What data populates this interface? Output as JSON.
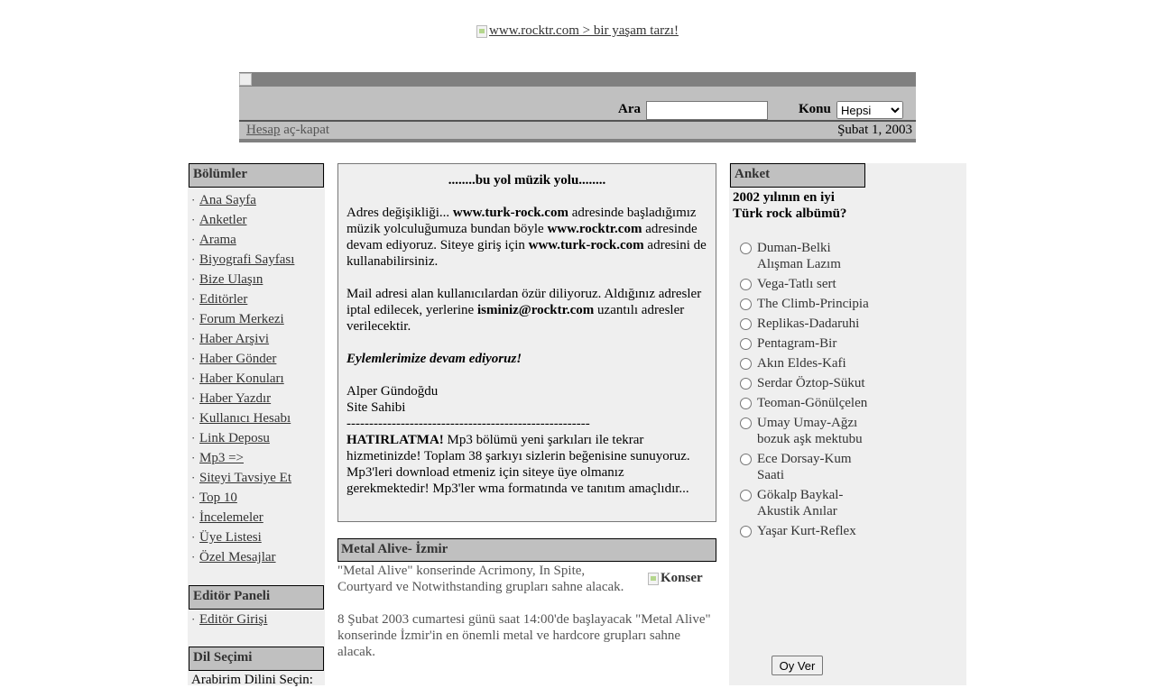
{
  "banner": {
    "alt": "www.rocktr.com > bir yaşam tarzı!"
  },
  "header": {
    "search_label": "Ara",
    "search_value": "",
    "topic_label": "Konu",
    "topic_selected": "Hepsi",
    "account_link": "Hesap",
    "account_toggle": "aç-kapat",
    "date": "Şubat 1, 2003"
  },
  "sidebar": {
    "sections_title": "Bölümler",
    "items": [
      {
        "label": "Ana Sayfa"
      },
      {
        "label": "Anketler"
      },
      {
        "label": "Arama"
      },
      {
        "label": "Biyografi Sayfası"
      },
      {
        "label": "Bize Ulaşın"
      },
      {
        "label": "Editörler"
      },
      {
        "label": "Forum Merkezi"
      },
      {
        "label": "Haber Arşivi"
      },
      {
        "label": "Haber Gönder"
      },
      {
        "label": "Haber Konuları"
      },
      {
        "label": "Haber Yazdır"
      },
      {
        "label": "Kullanıcı Hesabı"
      },
      {
        "label": "Link Deposu"
      },
      {
        "label": "Mp3 =>"
      },
      {
        "label": "Siteyi Tavsiye Et"
      },
      {
        "label": "Top 10"
      },
      {
        "label": "İncelemeler"
      },
      {
        "label": "Üye Listesi"
      },
      {
        "label": "Özel Mesajlar"
      }
    ],
    "editor_title": "Editör Paneli",
    "editor_login": "Editör Girişi",
    "lang_title": "Dil Seçimi",
    "lang_text": "Arabirim Dilini Seçin:"
  },
  "intro": {
    "title": "........bu yol müzik yolu........",
    "p1_a": "Adres değişikliği... ",
    "p1_b": "www.turk-rock.com",
    "p1_c": " adresinde başladığımız müzik yolculuğumuza bundan böyle ",
    "p1_d": "www.rocktr.com",
    "p1_e": " adresinde devam ediyoruz. Siteye giriş için ",
    "p1_f": "www.turk-rock.com",
    "p1_g": " adresini de kullanabilirsiniz.",
    "p2_a": "Mail adresi alan kullanıcılardan özür diliyoruz. Aldığınız adresler iptal edilecek, yerlerine ",
    "p2_b": "isminiz@rocktr.com",
    "p2_c": " uzantılı adresler verilecektir.",
    "p3": "Eylemlerimize devam ediyoruz!",
    "sign_name": "Alper Gündoğdu",
    "sign_role": "Site Sahibi",
    "divider": "------------------------------------------------------",
    "note_bold": "HATIRLATMA!",
    "note_text": " Mp3 bölümü yeni şarkıları ile tekrar hizmetinizde! Toplam 38 şarkıyı sizlerin beğenisine sunuyoruz. Mp3'leri download etmeniz için siteye üye olmanız gerekmektedir! Mp3'ler wma formatında ve tanıtım amaçlıdır..."
  },
  "article": {
    "title": "Metal Alive- İzmir",
    "img_alt": "Konser",
    "p1": "\"Metal Alive\" konserinde Acrimony, In Spite, Courtyard ve Notwithstanding grupları sahne alacak.",
    "p2": "8 Şubat 2003 cumartesi günü saat 14:00'de başlayacak \"Metal Alive\" konserinde İzmir'in en önemli metal ve hardcore grupları sahne alacak."
  },
  "poll": {
    "title": "Anket",
    "question": "2002 yılının en iyi Türk rock albümü?",
    "options": [
      {
        "label": "Duman-Belki Alışman Lazım"
      },
      {
        "label": "Vega-Tatlı sert"
      },
      {
        "label": "The Climb-Principia"
      },
      {
        "label": "Replikas-Dadaruhi"
      },
      {
        "label": "Pentagram-Bir"
      },
      {
        "label": "Akın Eldes-Kafi"
      },
      {
        "label": "Serdar Öztop-Sükut"
      },
      {
        "label": "Teoman-Gönülçelen"
      },
      {
        "label": "Umay Umay-Ağzı bozuk aşk mektubu"
      },
      {
        "label": "Ece Dorsay-Kum Saati"
      },
      {
        "label": "Gökalp Baykal-Akustik Anılar"
      },
      {
        "label": "Yaşar Kurt-Reflex"
      }
    ],
    "vote_label": "Oy Ver"
  }
}
